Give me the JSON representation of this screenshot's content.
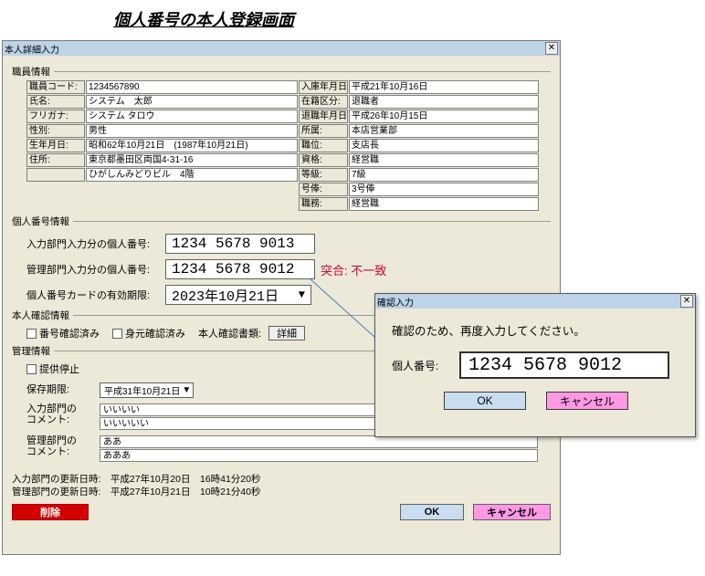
{
  "page_title": "個人番号の本人登録画面",
  "main": {
    "title": "本人詳細入力",
    "close": "✕",
    "groups": {
      "emp": "職員情報",
      "num": "個人番号情報",
      "conf": "本人確認情報",
      "mng": "管理情報"
    },
    "emp": {
      "emp_code_l": "職員コード:",
      "emp_code_v": "1234567890",
      "hire_l": "入庫年月日:",
      "hire_v": "平成21年10月16日",
      "name_l": "氏名:",
      "name_v": "システム　太郎",
      "enrol_l": "在籍区分:",
      "enrol_v": "退職者",
      "furi_l": "フリガナ:",
      "furi_v": "システム タロウ",
      "retire_l": "退職年月日:",
      "retire_v": "平成26年10月15日",
      "sex_l": "性別:",
      "sex_v": "男性",
      "dept_l": "所属:",
      "dept_v": "本店営業部",
      "birth_l": "生年月日:",
      "birth_v": "昭和62年10月21日　(1987年10月21日)",
      "post_l": "職位:",
      "post_v": "支店長",
      "addr_l": "住所:",
      "addr_v1": "東京都墨田区両国4-31-16",
      "addr_v2": "ひがしんみどりビル　4階",
      "qual_l": "資格:",
      "qual_v": "経営職",
      "grade_l": "等級:",
      "grade_v": "7級",
      "line_l": "号俸:",
      "line_v": "3号俸",
      "job_l": "職務:",
      "job_v": "経営職"
    },
    "num": {
      "input_dept_l": "入力部門入力分の個人番号:",
      "input_dept_v": "1234 5678 9013",
      "mgmt_dept_l": "管理部門入力分の個人番号:",
      "mgmt_dept_v": "1234 5678 9012",
      "match_l": "突合:",
      "match_v": "不一致",
      "card_l": "個人番号カードの有効期限:",
      "card_v": "2023年10月21日",
      "card_tri": "▼"
    },
    "conf": {
      "chk1": "番号確認済み",
      "chk2": "身元確認済み",
      "doc_l": "本人確認書類:",
      "detail_btn": "詳細"
    },
    "mng": {
      "stop_chk": "提供停止",
      "retain_l": "保存期限:",
      "retain_v": "平成31年10月21日",
      "retain_tri": "▼",
      "in_cmt_l": "入力部門の\nコメント:",
      "in_cmt_v1": "いいいい",
      "in_cmt_v2": "いいいいい",
      "mg_cmt_l": "管理部門の\nコメント:",
      "mg_cmt_v1": "ああ",
      "mg_cmt_v2": "あああ"
    },
    "footer": {
      "line1": "入力部門の更新日時:　平成27年10月20日　16時41分20秒",
      "line2": "管理部門の更新日時:　平成27年10月21日　10時21分40秒",
      "delete": "削除",
      "ok": "OK",
      "cancel": "キャンセル"
    }
  },
  "popup": {
    "title": "確認入力",
    "close": "✕",
    "msg": "確認のため、再度入力してください。",
    "fld_l": "個人番号:",
    "fld_v": "1234 5678 9012",
    "ok": "OK",
    "cancel": "キャンセル"
  }
}
